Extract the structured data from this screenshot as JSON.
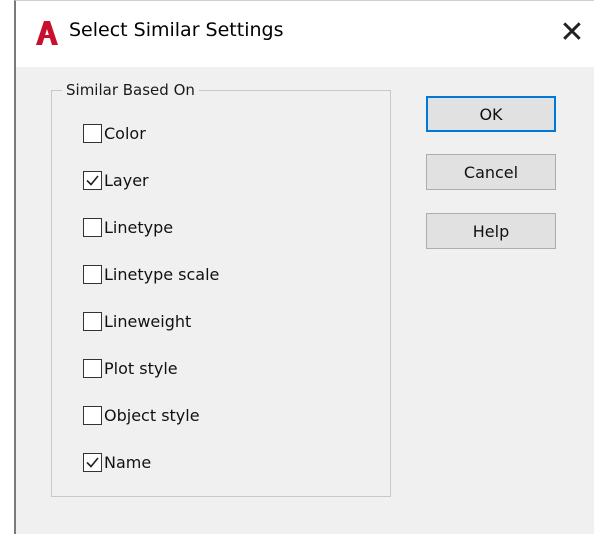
{
  "window": {
    "title": "Select Similar Settings",
    "close_symbol": "✕",
    "app_icon": "autocad-a-icon",
    "accent_color": "#c8102e"
  },
  "group": {
    "legend": "Similar Based On",
    "options": [
      {
        "label": "Color",
        "checked": false
      },
      {
        "label": "Layer",
        "checked": true
      },
      {
        "label": "Linetype",
        "checked": false
      },
      {
        "label": "Linetype scale",
        "checked": false
      },
      {
        "label": "Lineweight",
        "checked": false
      },
      {
        "label": "Plot style",
        "checked": false
      },
      {
        "label": "Object style",
        "checked": false
      },
      {
        "label": "Name",
        "checked": true
      }
    ]
  },
  "buttons": {
    "ok": "OK",
    "cancel": "Cancel",
    "help": "Help"
  }
}
